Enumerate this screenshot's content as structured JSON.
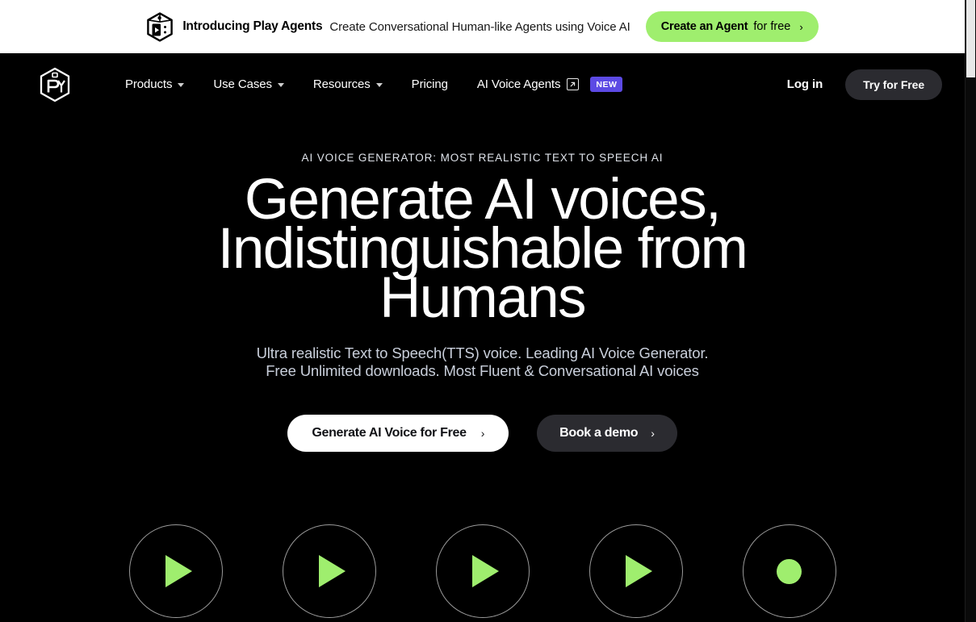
{
  "banner": {
    "logo_icon": "playht-cube-logo-icon",
    "title": "Introducing Play Agents",
    "subtitle": "Create Conversational Human-like Agents using Voice AI",
    "cta_bold": "Create an Agent",
    "cta_light": "for free",
    "cta_chevron": "›",
    "cta_bg": "#9FEE6E"
  },
  "nav": {
    "logo_icon": "playht-hex-logo-icon",
    "items": [
      {
        "label": "Products",
        "has_caret": true,
        "external": false,
        "badge": ""
      },
      {
        "label": "Use Cases",
        "has_caret": true,
        "external": false,
        "badge": ""
      },
      {
        "label": "Resources",
        "has_caret": true,
        "external": false,
        "badge": ""
      },
      {
        "label": "Pricing",
        "has_caret": false,
        "external": false,
        "badge": ""
      },
      {
        "label": "AI Voice Agents",
        "has_caret": false,
        "external": true,
        "badge": "NEW"
      }
    ],
    "login_label": "Log in",
    "try_label": "Try for Free",
    "badge_color": "#5C4AE4",
    "try_bg": "#2B2B30"
  },
  "hero": {
    "eyebrow": "AI VOICE GENERATOR: MOST REALISTIC TEXT TO SPEECH AI",
    "headline_line1": "Generate AI voices,",
    "headline_line2": "Indistinguishable from",
    "headline_line3": "Humans",
    "subhead_line1": "Ultra realistic Text to Speech(TTS) voice. Leading AI Voice Generator.",
    "subhead_line2": "Free Unlimited downloads. Most Fluent & Conversational AI voices",
    "primary_cta": "Generate AI Voice for Free",
    "primary_chevron": "›",
    "secondary_cta": "Book a demo",
    "secondary_chevron": "›"
  },
  "players": {
    "accent_color": "#9FEE6E",
    "items": [
      {
        "icon": "play-icon",
        "name": "voice-sample-1"
      },
      {
        "icon": "play-icon",
        "name": "voice-sample-2"
      },
      {
        "icon": "play-icon",
        "name": "voice-sample-3"
      },
      {
        "icon": "play-icon",
        "name": "voice-sample-4"
      },
      {
        "icon": "record-icon",
        "name": "voice-record"
      }
    ]
  },
  "scrollbar": {
    "position": "right",
    "thumb_top_pct": 0
  }
}
